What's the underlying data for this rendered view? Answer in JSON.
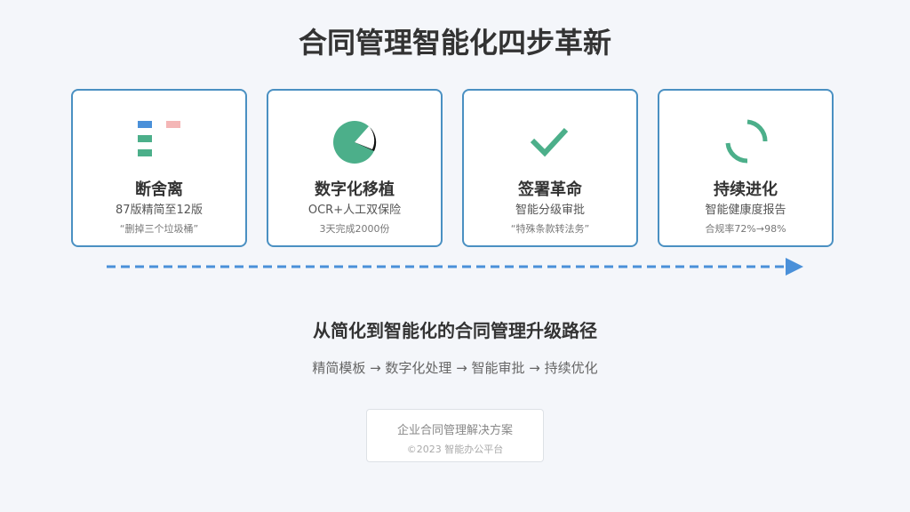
{
  "page": {
    "title": "合同管理智能化四步革新",
    "subtitle": "从简化到智能化的合同管理升级路径",
    "flow": "精简模板 → 数字化处理 → 智能审批 → 持续优化"
  },
  "steps": [
    {
      "name": "断舍离",
      "desc": "87版精简至12版",
      "note": "“删掉三个垃圾桶”",
      "icon": "list-blocks-icon"
    },
    {
      "name": "数字化移植",
      "desc": "OCR+人工双保险",
      "note": "3天完成2000份",
      "icon": "pie-progress-icon"
    },
    {
      "name": "签署革命",
      "desc": "智能分级审批",
      "note": "“特殊条款转法务”",
      "icon": "checkmark-icon"
    },
    {
      "name": "持续进化",
      "desc": "智能健康度报告",
      "note": "合规率72%→98%",
      "icon": "refresh-cycle-icon"
    }
  ],
  "footer": {
    "company": "企业合同管理解决方案",
    "copyright": "©2023 智能办公平台"
  },
  "colors": {
    "card_border": "#4a90c2",
    "accent_green": "#4caf8a",
    "accent_blue": "#4a90d9",
    "accent_pink": "#f4b6b6",
    "arrow": "#4a90d9"
  }
}
